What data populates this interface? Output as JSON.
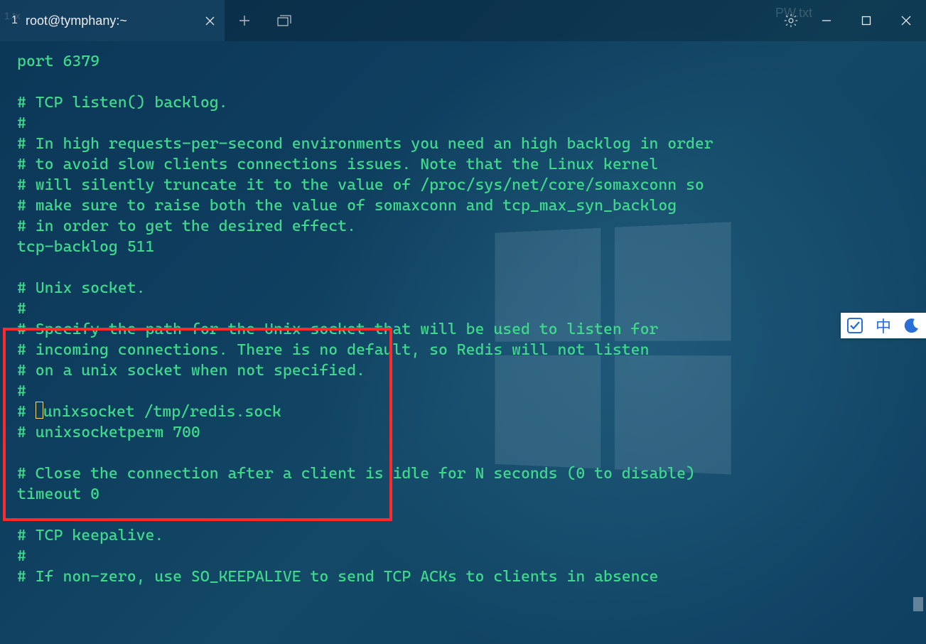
{
  "tab": {
    "index": "1",
    "bg_text": "1.tx",
    "title": "root@tymphany:~"
  },
  "background_file_hint": "PW.txt",
  "terminal_lines": [
    "port 6379",
    "",
    "# TCP listen() backlog.",
    "#",
    "# In high requests-per-second environments you need an high backlog in order",
    "# to avoid slow clients connections issues. Note that the Linux kernel",
    "# will silently truncate it to the value of /proc/sys/net/core/somaxconn so",
    "# make sure to raise both the value of somaxconn and tcp_max_syn_backlog",
    "# in order to get the desired effect.",
    "tcp-backlog 511",
    "",
    "# Unix socket.",
    "#",
    "# Specify the path for the Unix socket that will be used to listen for",
    "# incoming connections. There is no default, so Redis will not listen",
    "# on a unix socket when not specified.",
    "#"
  ],
  "cursor_line": {
    "before": "# ",
    "after": "unixsocket /tmp/redis.sock"
  },
  "terminal_lines_after": [
    "# unixsocketperm 700",
    "",
    "# Close the connection after a client is idle for N seconds (0 to disable)",
    "timeout 0",
    "",
    "# TCP keepalive.",
    "#",
    "# If non-zero, use SO_KEEPALIVE to send TCP ACKs to clients in absence"
  ],
  "ime": {
    "lang_label": "中"
  },
  "colors": {
    "text": "#3fd98c",
    "annotation": "#ff2a2a",
    "ime_accent": "#2a6fd6"
  }
}
